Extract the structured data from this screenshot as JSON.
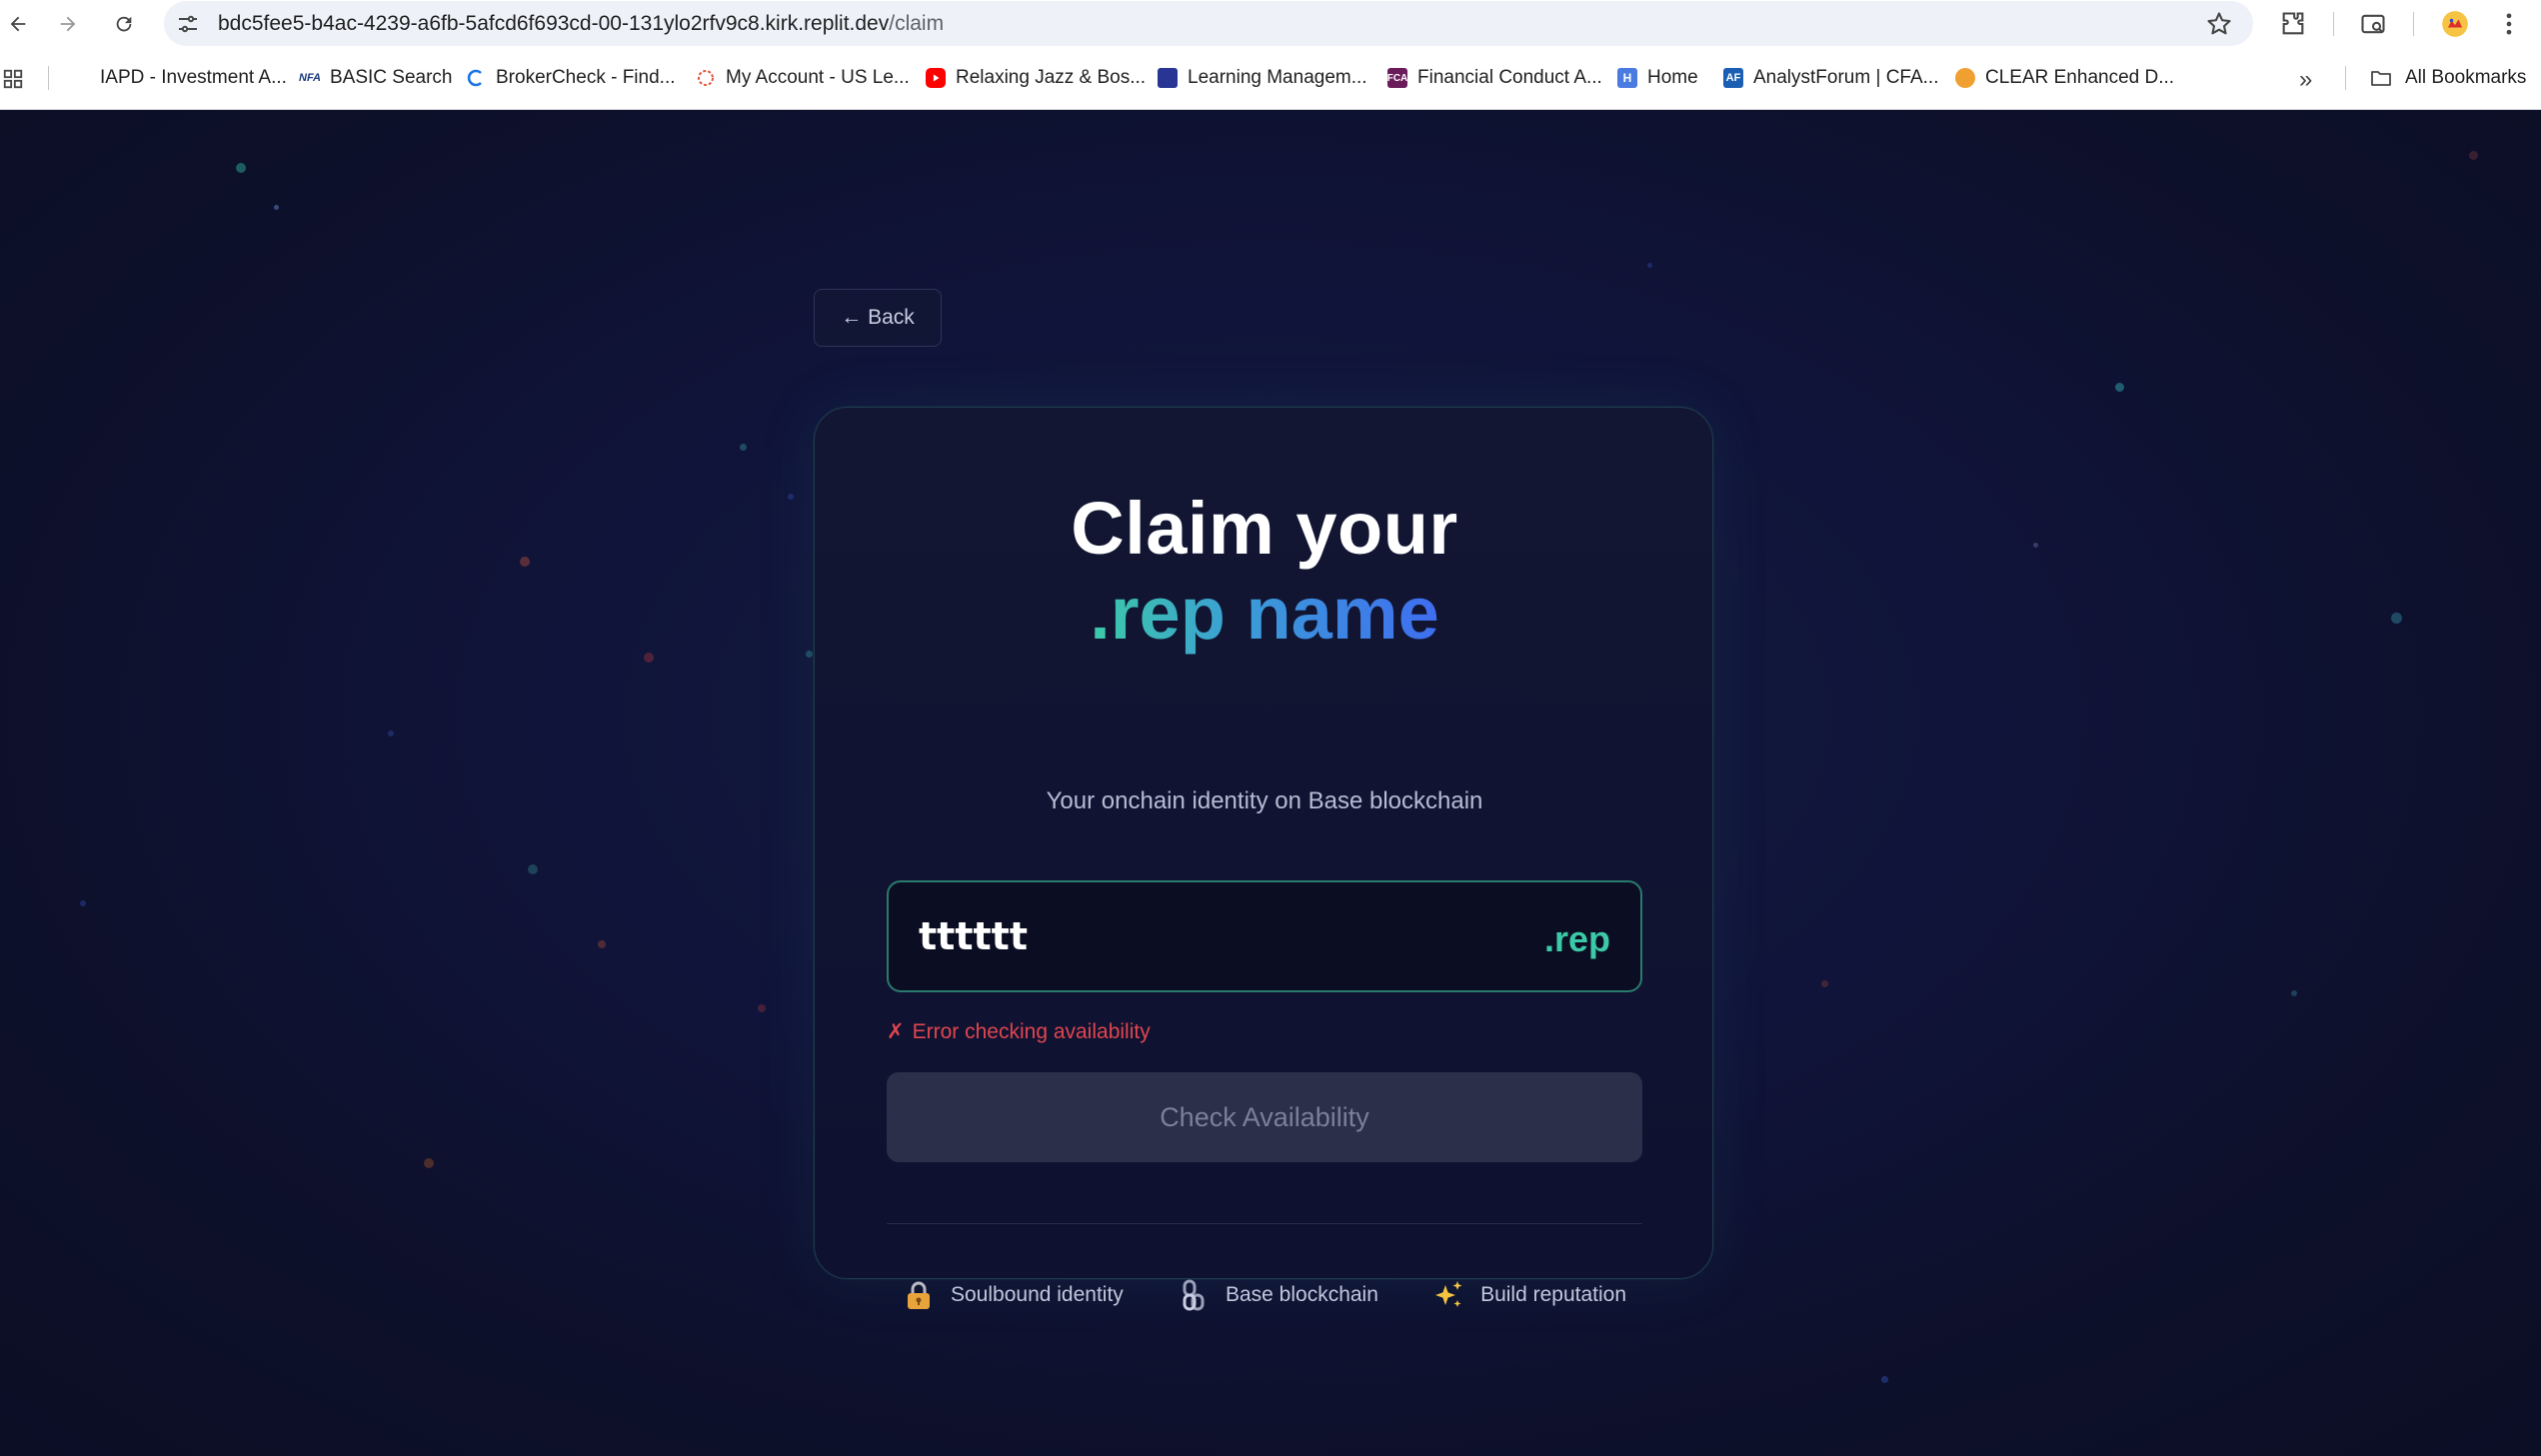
{
  "browser": {
    "url_host": "bdc5fee5-b4ac-4239-a6fb-5afcd6f693cd-00-131ylo2rfv9c8.kirk.replit.dev",
    "url_path": "/claim",
    "bookmarks": [
      {
        "label": "IAPD - Investment A...",
        "icon": "iapd-icon",
        "color": "#ffffff"
      },
      {
        "label": "BASIC Search",
        "icon": "nfa-icon",
        "color": "#ffffff"
      },
      {
        "label": "BrokerCheck - Find...",
        "icon": "brokercheck-icon",
        "color": "#ffffff"
      },
      {
        "label": "My Account - US Le...",
        "icon": "us-legal-icon",
        "color": "#ffffff"
      },
      {
        "label": "Relaxing Jazz & Bos...",
        "icon": "youtube-icon",
        "color": "#ff0000"
      },
      {
        "label": "Learning Managem...",
        "icon": "book-icon",
        "color": "#283593"
      },
      {
        "label": "Financial Conduct A...",
        "icon": "fca-icon",
        "color": "#6a1b5a"
      },
      {
        "label": "Home",
        "icon": "home-h-icon",
        "color": "#4a7be0"
      },
      {
        "label": "AnalystForum | CFA...",
        "icon": "af-icon",
        "color": "#1a5fb4"
      },
      {
        "label": "CLEAR Enhanced D...",
        "icon": "clear-icon",
        "color": "#f0a030"
      }
    ],
    "all_bookmarks_label": "All Bookmarks"
  },
  "page": {
    "back_label": "← Back",
    "title_line1": "Claim your",
    "title_line2": ".rep name",
    "subtitle": "Your onchain identity on Base blockchain",
    "name_input_value": "tttttt",
    "suffix": ".rep",
    "error_icon": "✗",
    "error_text": "Error checking availability",
    "check_button_label": "Check Availability",
    "features": [
      {
        "label": "Soulbound identity",
        "icon": "lock-icon"
      },
      {
        "label": "Base blockchain",
        "icon": "chain-icon"
      },
      {
        "label": "Build reputation",
        "icon": "sparkles-icon"
      }
    ]
  },
  "colors": {
    "accent_teal": "#3cc9a7",
    "accent_blue": "#3f6df0",
    "error_red": "#e0454f",
    "background": "#0d1029"
  }
}
